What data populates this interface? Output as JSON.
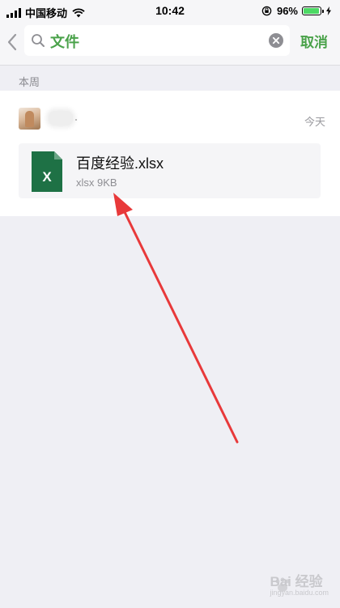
{
  "status_bar": {
    "carrier": "中国移动",
    "time": "10:42",
    "battery_percent": "96%",
    "battery_level": 0.96
  },
  "search": {
    "query": "文件",
    "cancel_label": "取消"
  },
  "results": {
    "section_label": "本周",
    "date": "今天",
    "file": {
      "name": "百度经验.xlsx",
      "meta": "xlsx 9KB",
      "icon_glyph": "X",
      "icon": "excel-file-icon",
      "icon_color": "#1e7145"
    }
  },
  "colors": {
    "accent": "#4aa24a",
    "annotation_arrow": "#e8393a"
  },
  "watermark": {
    "text": "Bai 经验",
    "sub": "jingyan.baidu.com"
  }
}
